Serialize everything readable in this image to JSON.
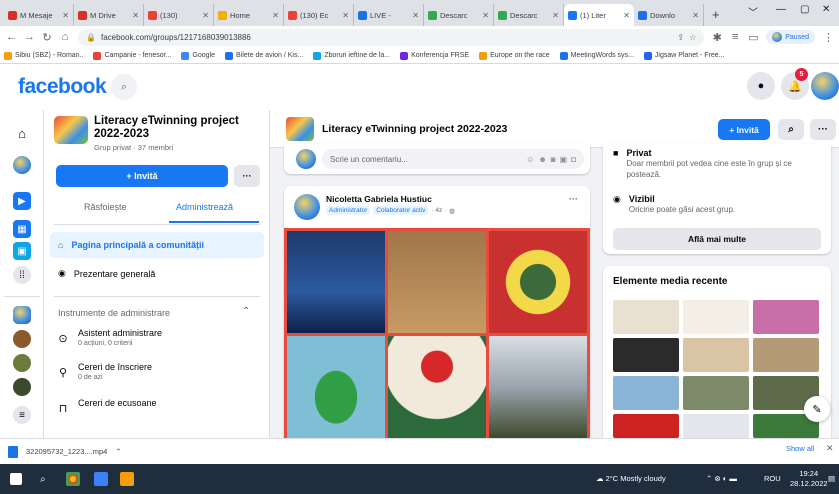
{
  "browser": {
    "tabs": [
      {
        "label": "M Mesaje",
        "color": "#d93025"
      },
      {
        "label": "M Drive",
        "color": "#d93025"
      },
      {
        "label": "(130)",
        "color": "#ea4335"
      },
      {
        "label": "Home",
        "color": "#f9ab00"
      },
      {
        "label": "(130) Ec",
        "color": "#ea4335"
      },
      {
        "label": "LIVE -",
        "color": "#1a73e8"
      },
      {
        "label": "Descarc",
        "color": "#34a853"
      },
      {
        "label": "Descarc",
        "color": "#34a853"
      },
      {
        "label": "(1) Liter",
        "color": "#1877f2"
      },
      {
        "label": "Downlo",
        "color": "#1a73e8"
      }
    ],
    "url": "facebook.com/groups/1217168039013886",
    "profile_badge": "Paused",
    "bookmarks": [
      "Sibiu (SBZ) - Roman..",
      "Campanie - fenesor...",
      "Google",
      "Bilete de avion / Kis...",
      "Zboruri ieftine de la...",
      "Konferencja FRSE",
      "Europe on the race",
      "MeetingWords sys...",
      "Jigsaw Planet - Free..."
    ]
  },
  "fb_header": {
    "logo": "facebook",
    "notification_count": "5"
  },
  "group": {
    "name": "Literacy eTwinning project 2022-2023",
    "sub": "Grup privat · 37 membri",
    "invite_label": "+ Invită",
    "more_label": "···",
    "tab_browse": "Răsfoiește",
    "tab_manage": "Administrează",
    "nav_home": "Pagina principală a comunității",
    "nav_overview": "Prezentare generală",
    "admin_tools_header": "Instrumente de administrare",
    "admin_items": [
      {
        "title": "Asistent administrare",
        "sub": "0 acțiuni, 0 criterii"
      },
      {
        "title": "Cereri de înscriere",
        "sub": "0 de azi"
      },
      {
        "title": "Cereri de ecusoane",
        "sub": ""
      }
    ]
  },
  "center": {
    "title": "Literacy eTwinning project 2022-2023",
    "invite_label": "+ Invită",
    "comment_placeholder": "Scrie un comentariu...",
    "post": {
      "author": "Nicoletta Gabriela Hustiuc",
      "role1": "Administrator",
      "role2": "Colaborator activ",
      "time": "· 4z ·"
    }
  },
  "right": {
    "privacy_title": "Privat",
    "privacy_desc": "Doar membrii pot vedea cine este în grup și ce postează.",
    "visible_title": "Vizibil",
    "visible_desc": "Oricine poate găsi acest grup.",
    "learn_more": "Află mai multe",
    "media_title": "Elemente media recente"
  },
  "downloads": {
    "file": "322095732_1223....mp4",
    "show_all": "Show all"
  },
  "taskbar": {
    "weather": "2°C Mostly cloudy",
    "lang": "ROU",
    "time": "19:24",
    "date": "28.12.2022"
  }
}
